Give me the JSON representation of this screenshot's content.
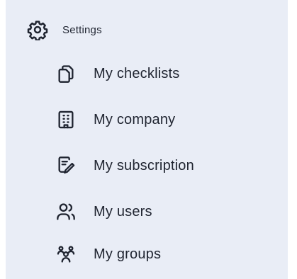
{
  "header": {
    "label": "Settings",
    "icon": "gear-icon"
  },
  "items": [
    {
      "label": "My checklists",
      "icon": "documents-icon"
    },
    {
      "label": "My company",
      "icon": "building-icon"
    },
    {
      "label": "My subscription",
      "icon": "contract-edit-icon"
    },
    {
      "label": "My users",
      "icon": "users-icon"
    },
    {
      "label": "My groups",
      "icon": "group-icon"
    }
  ],
  "colors": {
    "panel_background": "#e9edf6",
    "text": "#1f2430"
  }
}
